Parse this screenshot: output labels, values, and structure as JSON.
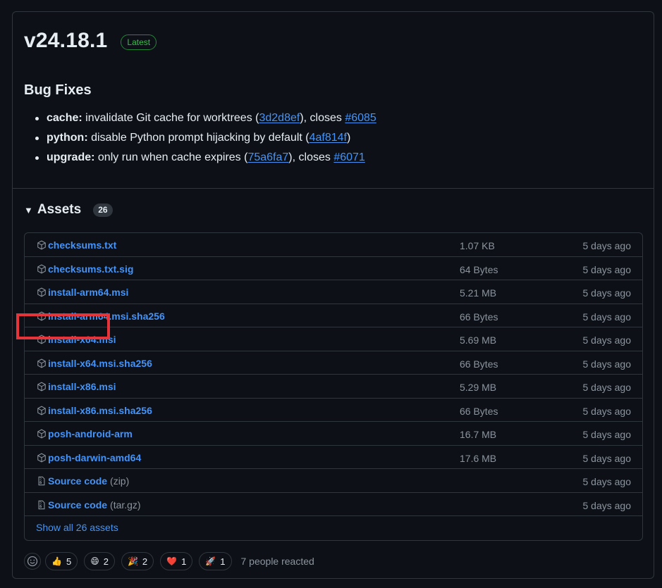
{
  "release": {
    "version": "v24.18.1",
    "badge": "Latest",
    "section_title": "Bug Fixes",
    "fixes": [
      {
        "scope": "cache",
        "text": " invalidate Git cache for worktrees (",
        "commit": "3d2d8ef",
        "mid": "), closes ",
        "issue": "#6085"
      },
      {
        "scope": "python",
        "text": " disable Python prompt hijacking by default (",
        "commit": "4af814f",
        "tail": ")"
      },
      {
        "scope": "upgrade",
        "text": " only run when cache expires (",
        "commit": "75a6fa7",
        "mid": "), closes ",
        "issue": "#6071"
      }
    ]
  },
  "assets": {
    "title": "Assets",
    "count": "26",
    "rows": [
      {
        "name": "checksums.txt",
        "size": "1.07 KB",
        "date": "5 days ago",
        "icon": "package-icon"
      },
      {
        "name": "checksums.txt.sig",
        "size": "64 Bytes",
        "date": "5 days ago",
        "icon": "package-icon"
      },
      {
        "name": "install-arm64.msi",
        "size": "5.21 MB",
        "date": "5 days ago",
        "icon": "package-icon"
      },
      {
        "name": "install-arm64.msi.sha256",
        "size": "66 Bytes",
        "date": "5 days ago",
        "icon": "package-icon"
      },
      {
        "name": "install-x64.msi",
        "size": "5.69 MB",
        "date": "5 days ago",
        "icon": "package-icon"
      },
      {
        "name": "install-x64.msi.sha256",
        "size": "66 Bytes",
        "date": "5 days ago",
        "icon": "package-icon"
      },
      {
        "name": "install-x86.msi",
        "size": "5.29 MB",
        "date": "5 days ago",
        "icon": "package-icon"
      },
      {
        "name": "install-x86.msi.sha256",
        "size": "66 Bytes",
        "date": "5 days ago",
        "icon": "package-icon"
      },
      {
        "name": "posh-android-arm",
        "size": "16.7 MB",
        "date": "5 days ago",
        "icon": "package-icon"
      },
      {
        "name": "posh-darwin-amd64",
        "size": "17.6 MB",
        "date": "5 days ago",
        "icon": "package-icon"
      },
      {
        "name": "Source code",
        "suffix": "(zip)",
        "size": "",
        "date": "5 days ago",
        "icon": "file-zip-icon"
      },
      {
        "name": "Source code",
        "suffix": "(tar.gz)",
        "size": "",
        "date": "5 days ago",
        "icon": "file-zip-icon"
      }
    ],
    "show_all": "Show all 26 assets"
  },
  "reactions": {
    "items": [
      {
        "emoji": "👍",
        "icon": "thumbs-up-icon",
        "count": "5"
      },
      {
        "emoji": "😄",
        "icon": "laugh-icon",
        "count": "2"
      },
      {
        "emoji": "🎉",
        "icon": "hooray-icon",
        "count": "2"
      },
      {
        "emoji": "❤️",
        "icon": "heart-icon",
        "count": "1"
      },
      {
        "emoji": "🚀",
        "icon": "rocket-icon",
        "count": "1"
      }
    ],
    "summary": "7 people reacted"
  },
  "colors": {
    "background": "#0d1117",
    "border": "#30363d",
    "link": "#4493f8",
    "muted": "#8b949e",
    "latest_green": "#3fb950",
    "highlight_red": "#e5353b"
  }
}
